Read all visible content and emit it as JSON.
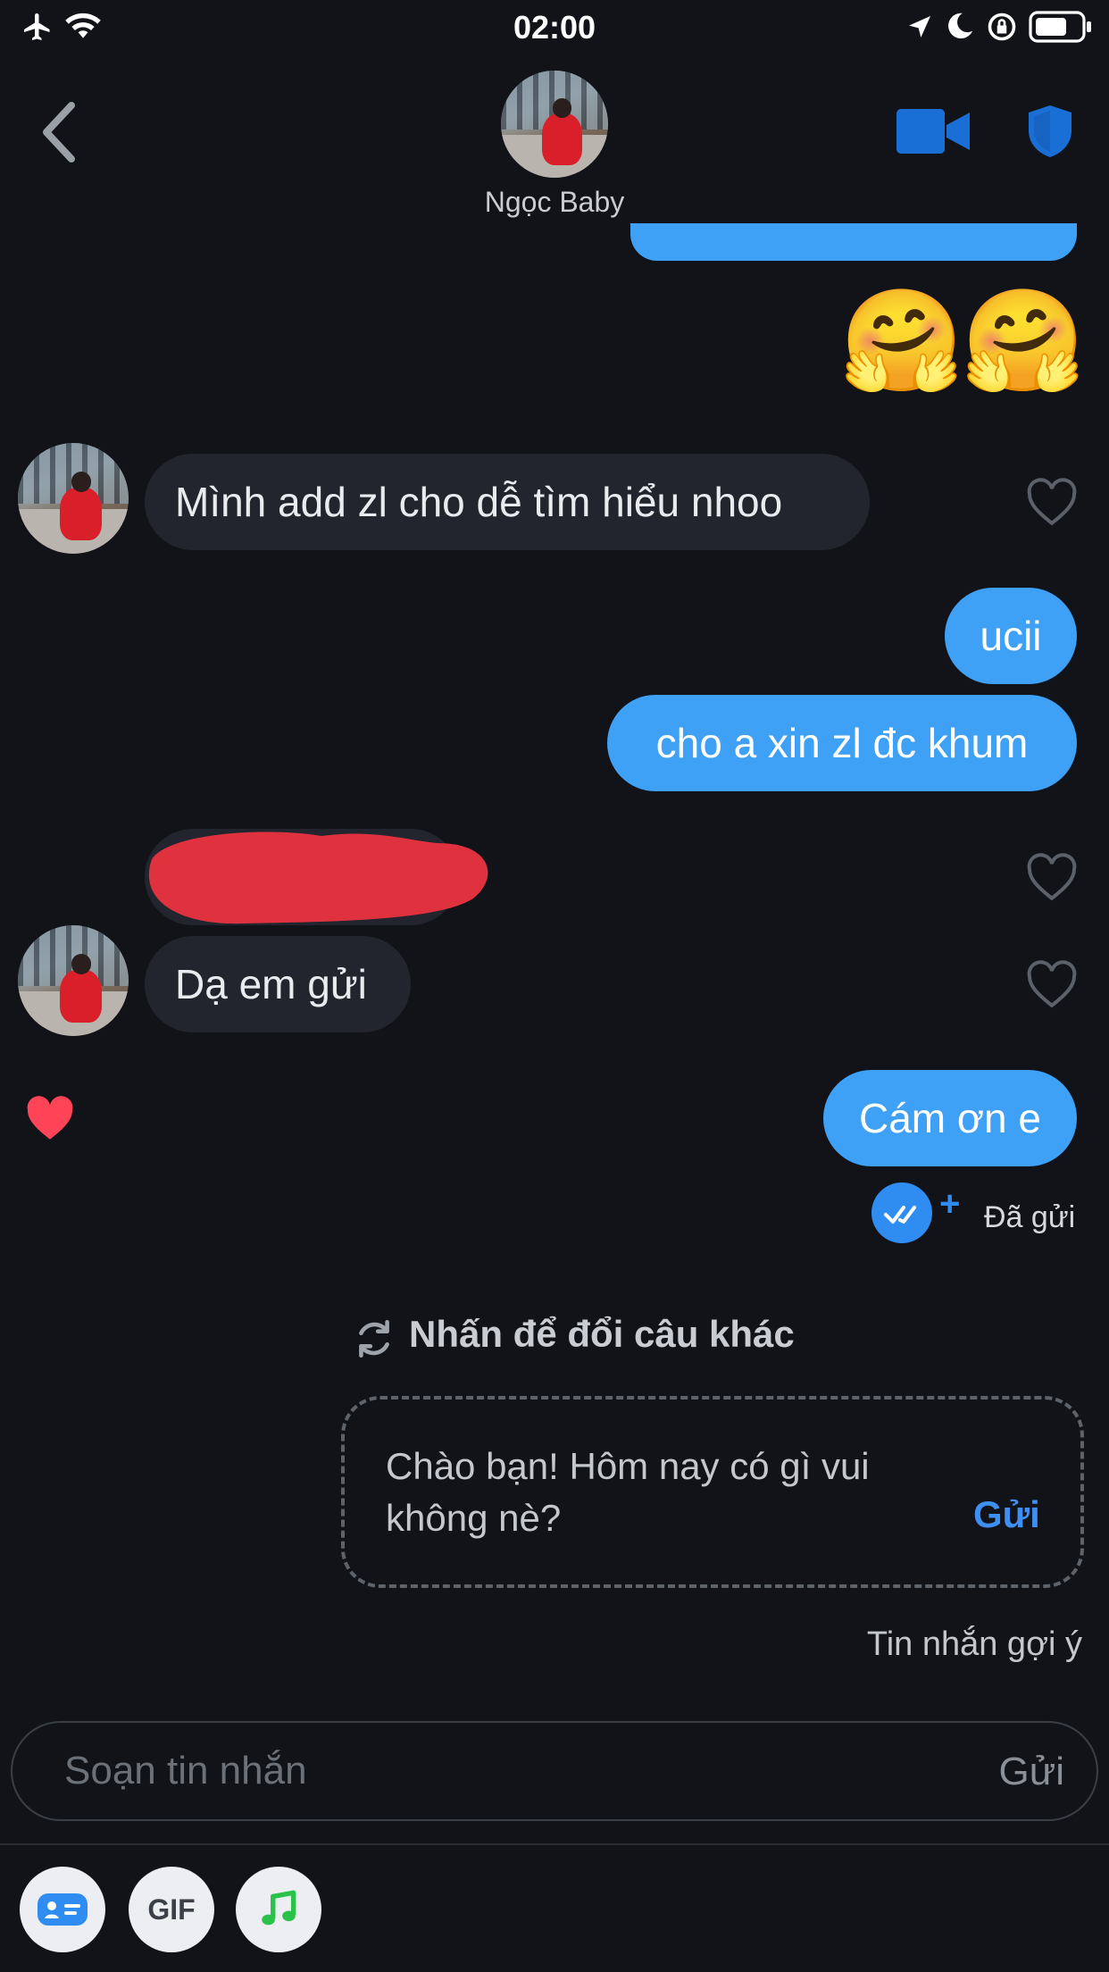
{
  "status_bar": {
    "time": "02:00"
  },
  "header": {
    "back_icon": "chevron-left-icon",
    "contact_name": "Ngọc Baby",
    "video_icon": "video-camera-icon",
    "shield_icon": "shield-icon",
    "accent_color": "#1a6fd6"
  },
  "messages": {
    "emoji_pair": [
      "🤗",
      "🤗"
    ],
    "incoming_1": "Mình add zl cho dễ tìm hiểu nhoo",
    "outgoing_1": "ucii",
    "outgoing_2": "cho a xin zl đc khum",
    "incoming_3": "Dạ em gửi",
    "outgoing_3": "Cám ơn e",
    "sent_status": "Đã gửi",
    "liked_color": "#ff4458",
    "outgoing_color": "#3fa1f5"
  },
  "suggestion": {
    "refresh_label": "Nhấn để đổi câu khác",
    "text": "Chào bạn! Hôm nay có gì vui không nè?",
    "send_label": "Gửi",
    "caption": "Tin nhắn gợi ý"
  },
  "composer": {
    "placeholder": "Soạn tin nhắn",
    "send_label": "Gửi"
  },
  "toolbar": {
    "gif_label": "GIF",
    "sticker_icon": "card-icon",
    "music_icon": "music-note-icon"
  }
}
